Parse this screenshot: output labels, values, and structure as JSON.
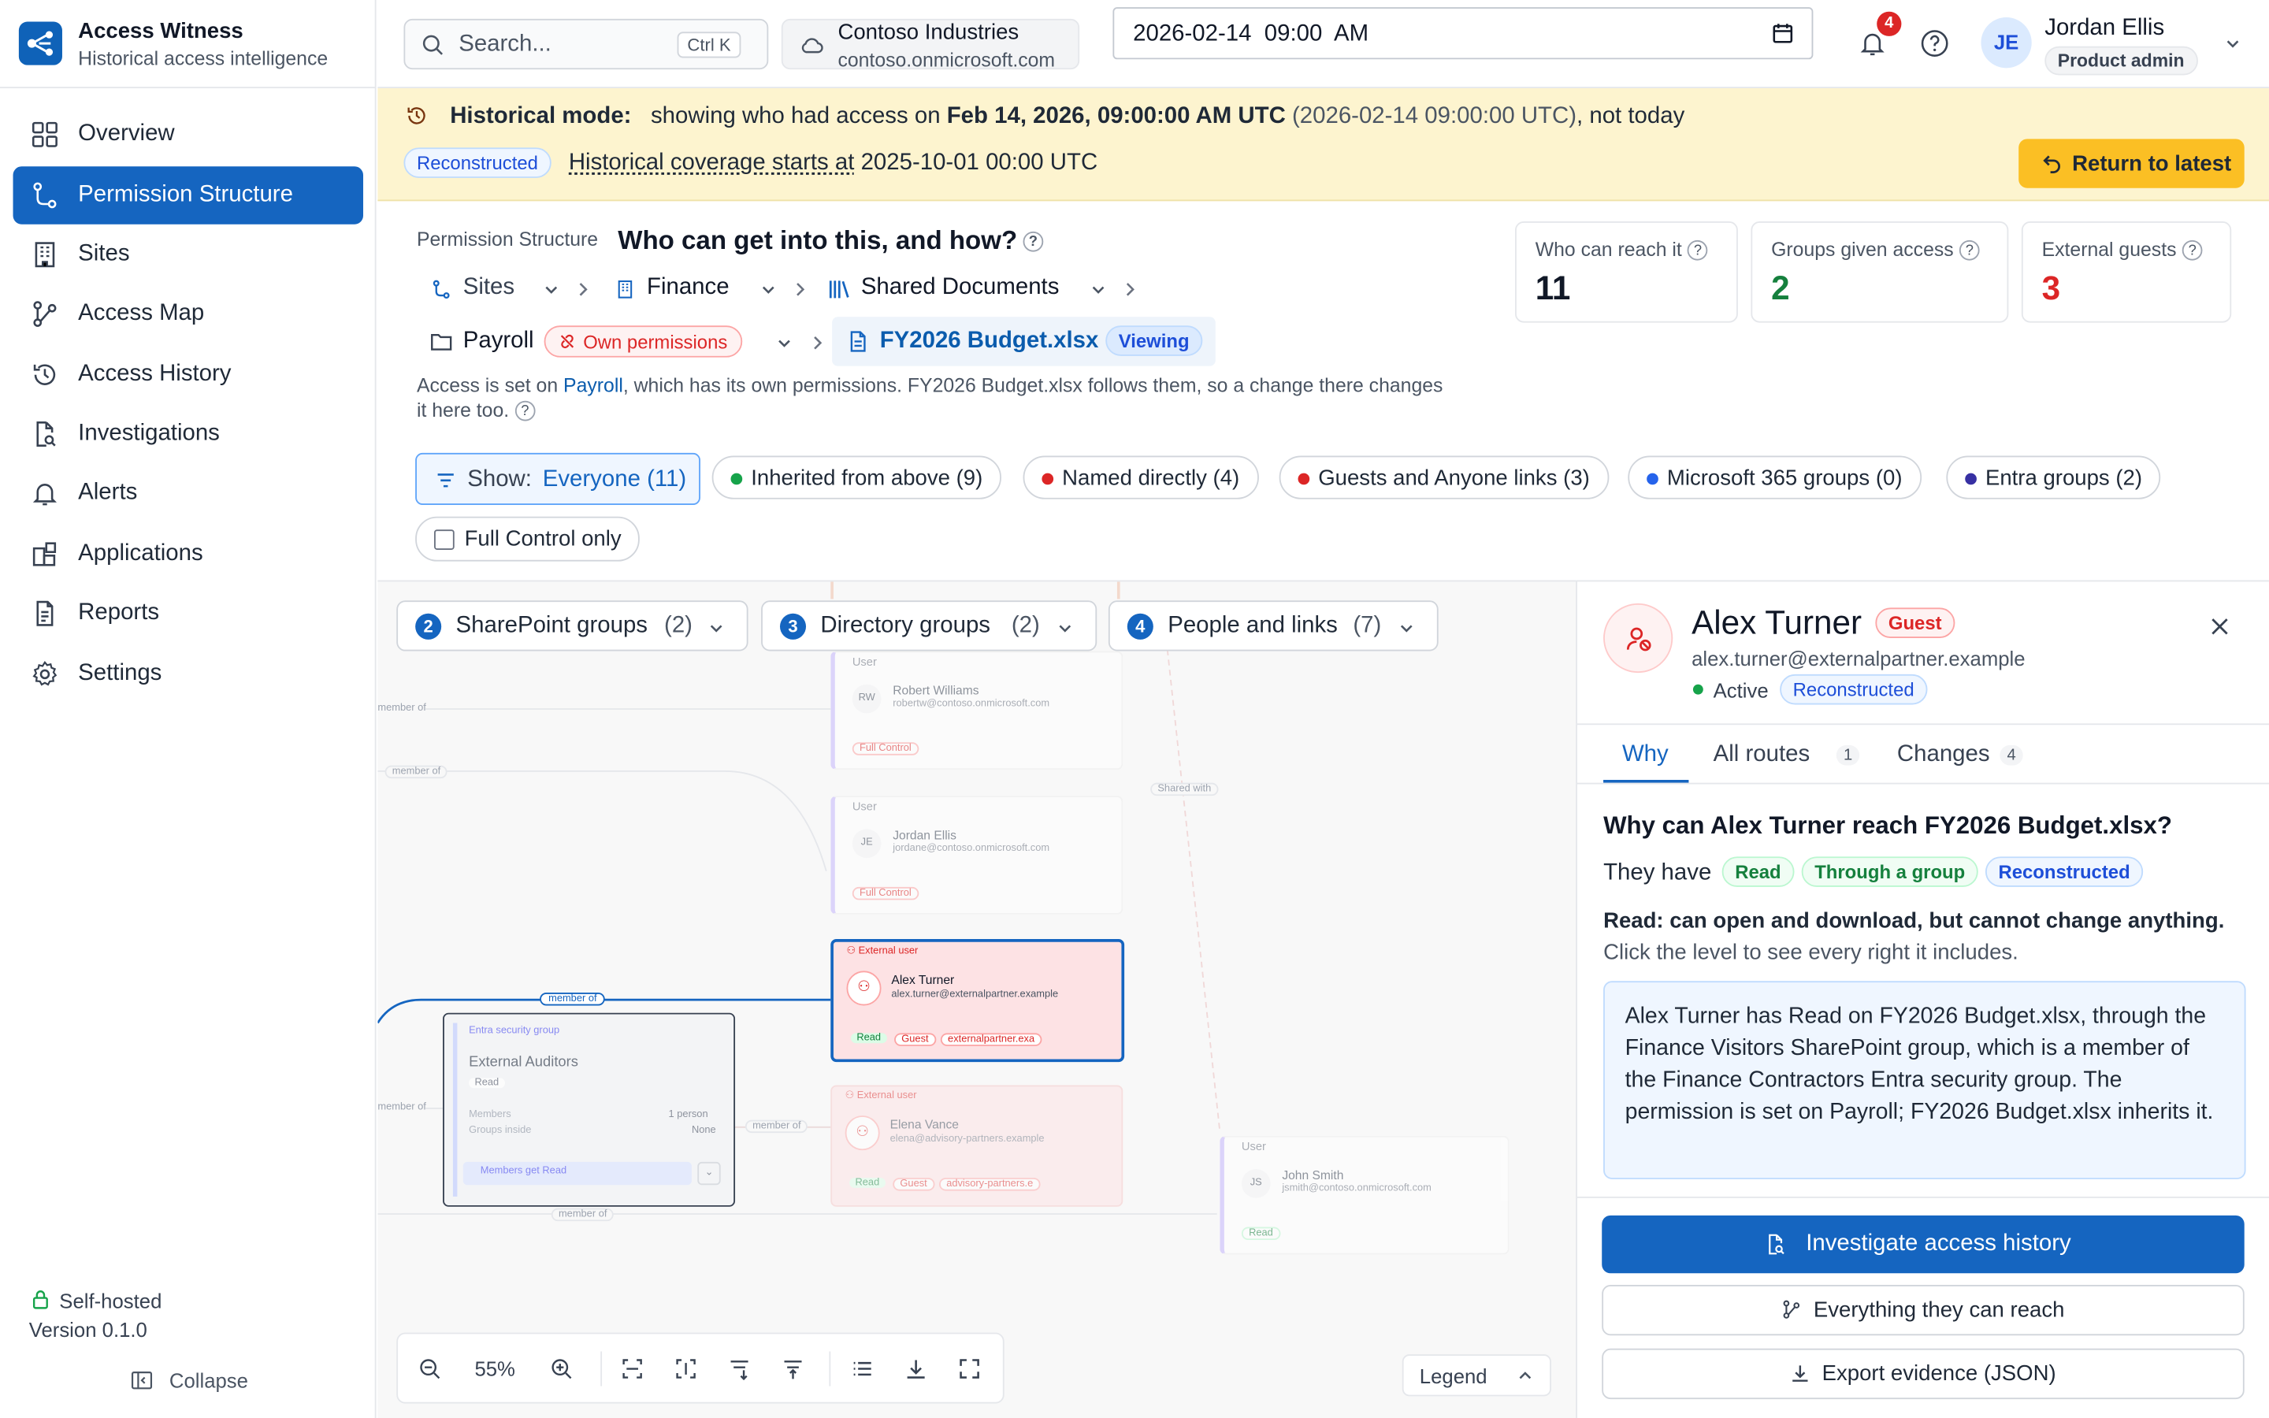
{
  "app": {
    "name": "Access Witness",
    "tagline": "Historical access intelligence"
  },
  "sidebar": {
    "items": [
      {
        "label": "Overview",
        "icon": "grid-icon"
      },
      {
        "label": "Permission Structure",
        "icon": "hierarchy-icon",
        "active": true
      },
      {
        "label": "Sites",
        "icon": "building-icon"
      },
      {
        "label": "Access Map",
        "icon": "graph-icon"
      },
      {
        "label": "Access History",
        "icon": "history-icon"
      },
      {
        "label": "Investigations",
        "icon": "file-search-icon"
      },
      {
        "label": "Alerts",
        "icon": "bell-icon"
      },
      {
        "label": "Applications",
        "icon": "apps-icon"
      },
      {
        "label": "Reports",
        "icon": "document-icon"
      },
      {
        "label": "Settings",
        "icon": "gear-icon"
      }
    ],
    "hosting": "Self-hosted",
    "version": "Version 0.1.0",
    "collapse": "Collapse"
  },
  "topbar": {
    "search_placeholder": "Search...",
    "search_shortcut": "Ctrl K",
    "tenant_name": "Contoso Industries",
    "tenant_domain": "contoso.onmicrosoft.com",
    "datetime_value": "2026-02-14  09:00  AM",
    "notifications_count": "4",
    "user_initials": "JE",
    "user_name": "Jordan Ellis",
    "user_role": "Product admin"
  },
  "banner": {
    "label": "Historical mode:",
    "text_prefix": "showing who had access on",
    "date_bold": "Feb 14, 2026, 09:00:00 AM UTC",
    "date_iso": "(2026-02-14 09:00:00 UTC)",
    "text_suffix": ", not today",
    "badge": "Reconstructed",
    "coverage_label": "Historical coverage starts at",
    "coverage_value": "2025-10-01 00:00 UTC",
    "return_button": "Return to latest"
  },
  "header": {
    "section": "Permission Structure",
    "question": "Who can get into this, and how?",
    "breadcrumb": {
      "sites": "Sites",
      "finance": "Finance",
      "shared_documents": "Shared Documents",
      "payroll": "Payroll",
      "own_permissions": "Own permissions",
      "file": "FY2026 Budget.xlsx",
      "viewing": "Viewing"
    },
    "note_prefix": "Access is set on",
    "note_link": "Payroll",
    "note_line1_rest": ", which has its own permissions. FY2026 Budget.xlsx follows them, so a change there changes",
    "note_line2": "it here too."
  },
  "stats": [
    {
      "label": "Who can reach it",
      "value": "11",
      "color": "#111827"
    },
    {
      "label": "Groups given access",
      "value": "2",
      "color": "#15803d"
    },
    {
      "label": "External guests",
      "value": "3",
      "color": "#dc2626"
    }
  ],
  "filters": {
    "show_label": "Show:",
    "show_value": "Everyone (11)",
    "chips": [
      {
        "label": "Inherited from above",
        "count": "(9)",
        "color": "#16a34a"
      },
      {
        "label": "Named directly",
        "count": "(4)",
        "color": "#dc2626"
      },
      {
        "label": "Guests and Anyone links",
        "count": "(3)",
        "color": "#dc2626"
      },
      {
        "label": "Microsoft 365 groups",
        "count": "(0)",
        "color": "#2563eb"
      },
      {
        "label": "Entra groups",
        "count": "(2)",
        "color": "#3730a3"
      }
    ],
    "full_control": "Full Control only"
  },
  "graph": {
    "groups": [
      {
        "num": "2",
        "label": "SharePoint groups",
        "count": "(2)"
      },
      {
        "num": "3",
        "label": "Directory groups",
        "count": "(2)"
      },
      {
        "num": "4",
        "label": "People and links",
        "count": "(7)"
      }
    ],
    "edges": {
      "member_of": "member of",
      "shared_with": "Shared with"
    },
    "nodes": {
      "robert": {
        "type": "User",
        "initials": "RW",
        "name": "Robert Williams",
        "email": "robertw@contoso.onmicrosoft.com",
        "badge": "Full Control"
      },
      "jordan": {
        "type": "User",
        "initials": "JE",
        "name": "Jordan Ellis",
        "email": "jordane@contoso.onmicrosoft.com",
        "badge": "Full Control"
      },
      "alex": {
        "type": "External user",
        "name": "Alex Turner",
        "email": "alex.turner@externalpartner.example",
        "badges": [
          "Read",
          "Guest",
          "externalpartner.exa"
        ]
      },
      "elena": {
        "type": "External user",
        "name": "Elena Vance",
        "email": "elena@advisory-partners.example",
        "badges": [
          "Read",
          "Guest",
          "advisory-partners.e"
        ]
      },
      "john": {
        "type": "User",
        "initials": "JS",
        "name": "John Smith",
        "email": "jsmith@contoso.onmicrosoft.com",
        "badge": "Read"
      },
      "auditors": {
        "type": "Entra security group",
        "name": "External Auditors",
        "badge": "Read",
        "members_label": "Members",
        "members_value": "1 person",
        "groups_label": "Groups inside",
        "groups_value": "None",
        "action": "Members get Read"
      }
    },
    "zoom": "55%",
    "legend": "Legend"
  },
  "panel": {
    "name": "Alex Turner",
    "tag": "Guest",
    "email": "alex.turner@externalpartner.example",
    "status": "Active",
    "status_badge": "Reconstructed",
    "tabs": [
      {
        "label": "Why",
        "count": ""
      },
      {
        "label": "All routes",
        "count": "1"
      },
      {
        "label": "Changes",
        "count": "4"
      }
    ],
    "question": "Why can Alex Turner reach FY2026 Budget.xlsx?",
    "they_have": "They have",
    "badges": [
      "Read",
      "Through a group",
      "Reconstructed"
    ],
    "read_desc": "Read: can open and download, but cannot change anything.",
    "read_hint": "Click the level to see every right it includes.",
    "explanation": "Alex Turner has Read on FY2026 Budget.xlsx, through the Finance Visitors SharePoint group, which is a member of the Finance Contractors Entra security group. The permission is set on Payroll; FY2026 Budget.xlsx inherits it.",
    "primary_button": "Investigate access history",
    "reach_button": "Everything they can reach",
    "export_button": "Export evidence (JSON)"
  }
}
